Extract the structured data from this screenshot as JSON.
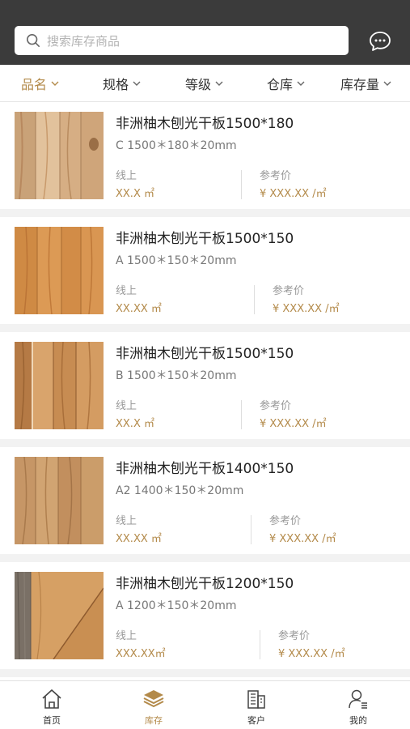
{
  "search": {
    "placeholder": "搜索库存商品",
    "icon": "search-icon"
  },
  "header": {
    "chat_icon": "chat-bubble-icon"
  },
  "filters": [
    {
      "label": "品名",
      "active": true
    },
    {
      "label": "规格",
      "active": false
    },
    {
      "label": "等级",
      "active": false
    },
    {
      "label": "仓库",
      "active": false
    },
    {
      "label": "库存量",
      "active": false
    }
  ],
  "items": [
    {
      "title": "非洲柚木刨光干板1500*180",
      "spec": "C 1500＊180＊20mm",
      "stock_label": "线上",
      "stock_value": "XX.X ㎡",
      "price_label": "参考价",
      "price_value": "¥ XXX.XX /㎡"
    },
    {
      "title": "非洲柚木刨光干板1500*150",
      "spec": "A 1500＊150＊20mm",
      "stock_label": "线上",
      "stock_value": "XX.XX ㎡",
      "price_label": "参考价",
      "price_value": "¥ XXX.XX /㎡"
    },
    {
      "title": "非洲柚木刨光干板1500*150",
      "spec": "B 1500＊150＊20mm",
      "stock_label": "线上",
      "stock_value": "XX.X ㎡",
      "price_label": "参考价",
      "price_value": "¥ XXX.XX /㎡"
    },
    {
      "title": "非洲柚木刨光干板1400*150",
      "spec": "A2 1400＊150＊20mm",
      "stock_label": "线上",
      "stock_value": "XX.XX ㎡",
      "price_label": "参考价",
      "price_value": "¥ XXX.XX /㎡"
    },
    {
      "title": "非洲柚木刨光干板1200*150",
      "spec": "A 1200＊150＊20mm",
      "stock_label": "线上",
      "stock_value": "XXX.XX㎡",
      "price_label": "参考价",
      "price_value": "¥ XXX.XX /㎡"
    }
  ],
  "tabs": [
    {
      "label": "首页",
      "icon": "home-icon",
      "active": false
    },
    {
      "label": "库存",
      "icon": "inventory-stack-icon",
      "active": true
    },
    {
      "label": "客户",
      "icon": "building-icon",
      "active": false
    },
    {
      "label": "我的",
      "icon": "profile-icon",
      "active": false
    }
  ],
  "colors": {
    "accent": "#b38a4a",
    "header_bg": "#3b3b3b",
    "page_bg": "#f2f2f2"
  }
}
